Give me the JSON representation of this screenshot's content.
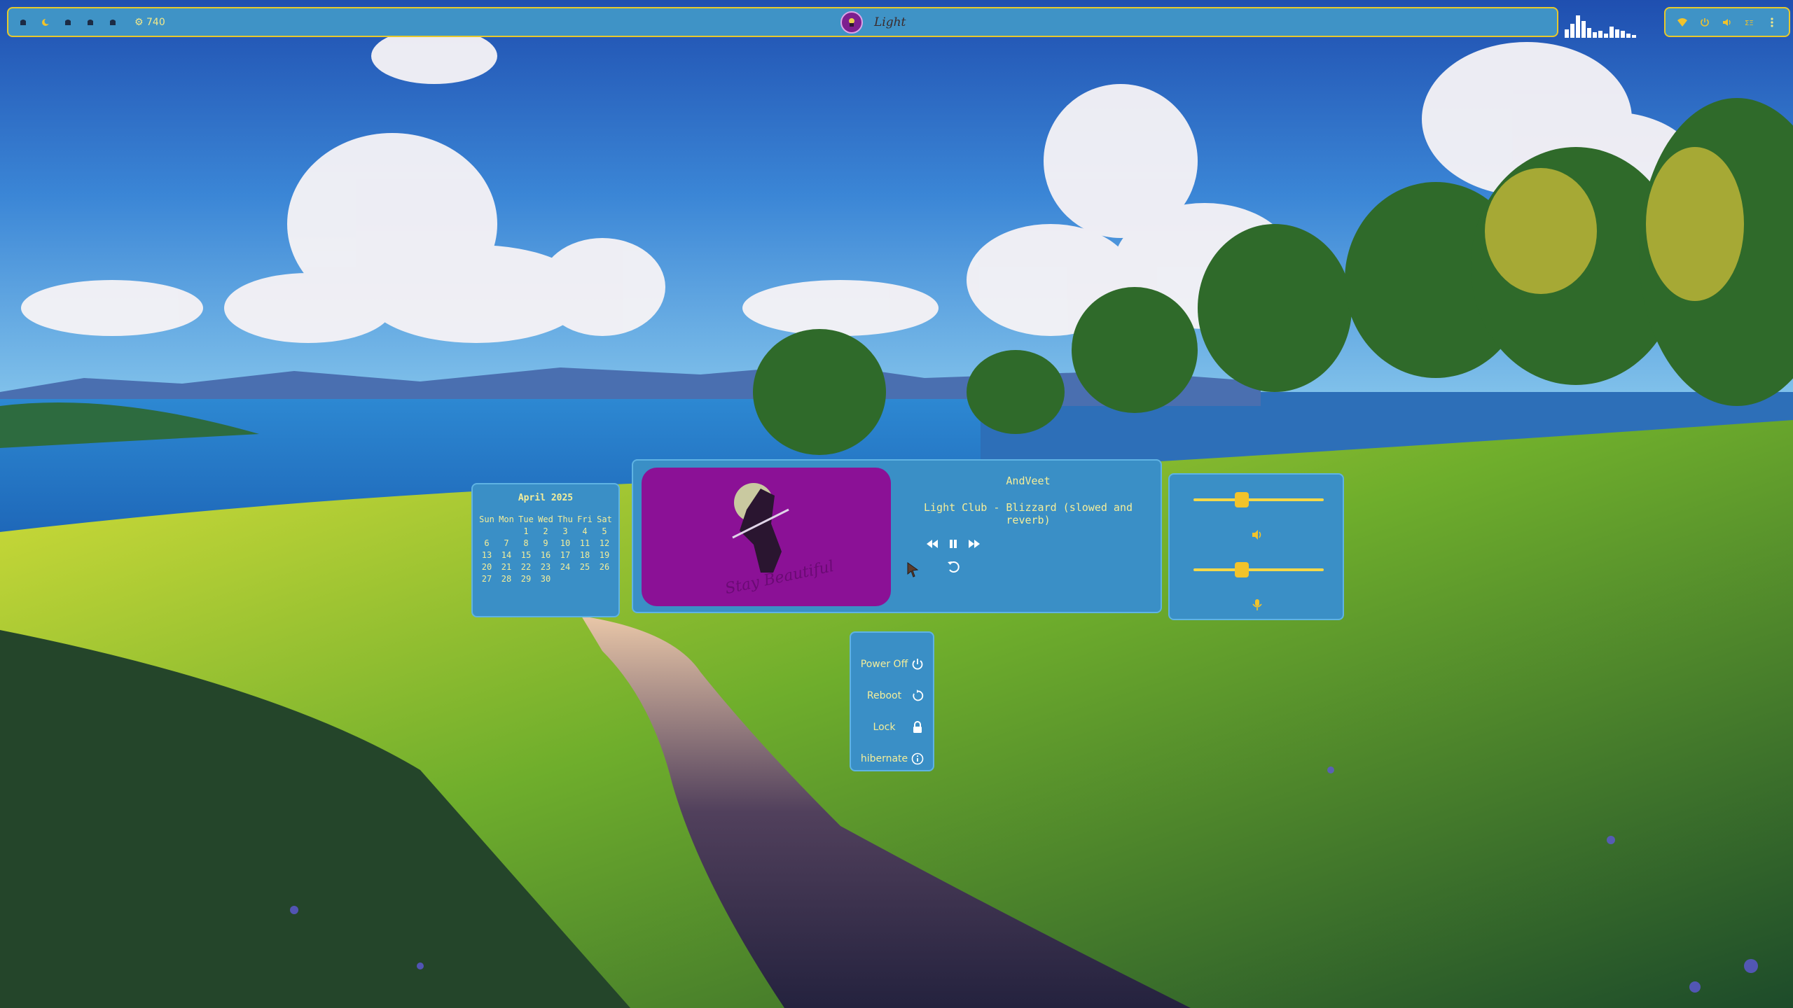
{
  "topbar": {
    "workspaces": [
      {
        "icon": "workspace-icon"
      },
      {
        "icon": "moon-icon"
      },
      {
        "icon": "workspace-icon"
      },
      {
        "icon": "workspace-icon"
      },
      {
        "icon": "workspace-icon"
      }
    ],
    "counter": "740",
    "window_title": "Light"
  },
  "tray": {
    "icons": [
      "wifi-icon",
      "power-icon",
      "volume-icon",
      "keyboard-layout-icon",
      "menu-icon"
    ]
  },
  "calendar": {
    "title": "April 2025",
    "weekdays": [
      "Sun",
      "Mon",
      "Tue",
      "Wed",
      "Thu",
      "Fri",
      "Sat"
    ],
    "days": [
      "",
      "",
      "1",
      "2",
      "3",
      "4",
      "5",
      "6",
      "7",
      "8",
      "9",
      "10",
      "11",
      "12",
      "13",
      "14",
      "15",
      "16",
      "17",
      "18",
      "19",
      "20",
      "21",
      "22",
      "23",
      "24",
      "25",
      "26",
      "27",
      "28",
      "29",
      "30",
      "",
      "",
      ""
    ]
  },
  "player": {
    "artist": "AndVeet",
    "song": "Light Club - Blizzard (slowed and reverb)",
    "state": "playing",
    "cover_color": "#8b1196"
  },
  "volume": {
    "output_level": 0.37,
    "input_level": 0.37
  },
  "power_menu": {
    "items": [
      {
        "label": "Power Off",
        "icon": "power-icon"
      },
      {
        "label": "Reboot",
        "icon": "reboot-icon"
      },
      {
        "label": "Lock",
        "icon": "lock-icon"
      },
      {
        "label": "hibernate",
        "icon": "info-icon"
      }
    ]
  },
  "colors": {
    "panel": "#3a8fc6",
    "accent": "#f2c32a",
    "text": "#f4ee9a"
  }
}
